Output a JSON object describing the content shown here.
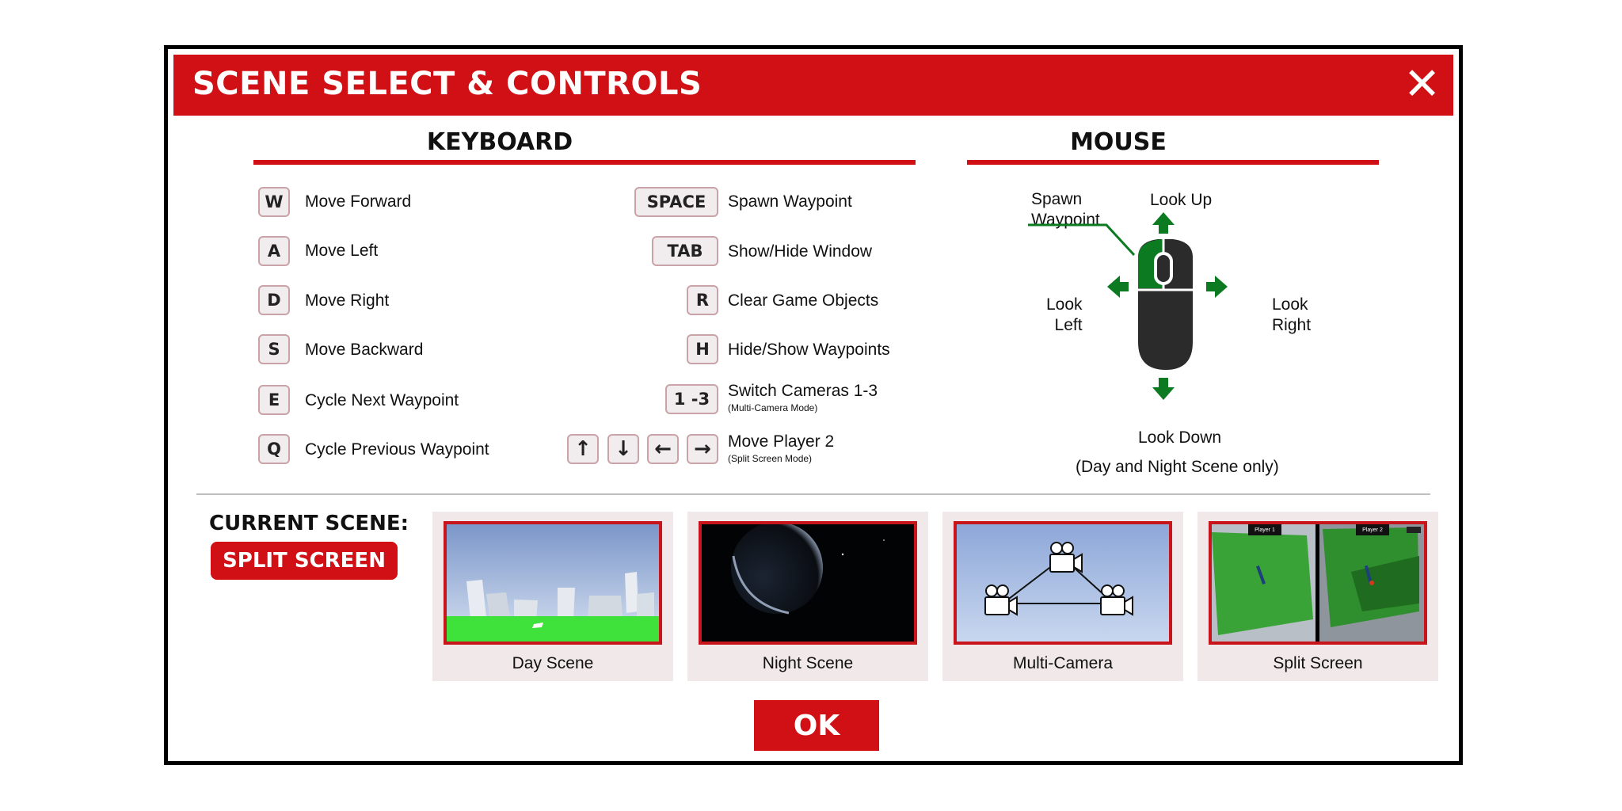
{
  "dialog": {
    "title": "SCENE SELECT & CONTROLS",
    "close_symbol": "✕"
  },
  "keyboard": {
    "heading": "KEYBOARD",
    "left": [
      {
        "key": "W",
        "action": "Move Forward"
      },
      {
        "key": "A",
        "action": "Move Left"
      },
      {
        "key": "D",
        "action": "Move Right"
      },
      {
        "key": "S",
        "action": "Move Backward"
      },
      {
        "key": "E",
        "action": "Cycle Next Waypoint"
      },
      {
        "key": "Q",
        "action": "Cycle Previous Waypoint"
      }
    ],
    "right": [
      {
        "key": "SPACE",
        "action": "Spawn Waypoint"
      },
      {
        "key": "TAB",
        "action": "Show/Hide Window"
      },
      {
        "key": "R",
        "action": "Clear Game Objects"
      },
      {
        "key": "H",
        "action": "Hide/Show Waypoints"
      },
      {
        "key": "1 -3",
        "action": "Switch Cameras 1-3",
        "note": "(Multi-Camera Mode)"
      },
      {
        "keys": [
          "↑",
          "↓",
          "←",
          "→"
        ],
        "action": "Move Player 2",
        "note": "(Split Screen Mode)"
      }
    ]
  },
  "mouse": {
    "heading": "MOUSE",
    "spawn_line1": "Spawn",
    "spawn_line2": "Waypoint",
    "look_up": "Look Up",
    "look_left_1": "Look",
    "look_left_2": "Left",
    "look_right_1": "Look",
    "look_right_2": "Right",
    "look_down": "Look Down",
    "note": "(Day and Night Scene only)",
    "colors": {
      "button_active": "#0c7a20",
      "body": "#2b2b2b",
      "arrow": "#0c7a20"
    }
  },
  "current_scene": {
    "label": "CURRENT SCENE:",
    "value": "SPLIT SCREEN"
  },
  "scenes": [
    {
      "label": "Day Scene"
    },
    {
      "label": "Night Scene"
    },
    {
      "label": "Multi-Camera"
    },
    {
      "label": "Split Screen",
      "p1": "Player 1",
      "p2": "Player 2"
    }
  ],
  "ok_label": "OK",
  "colors": {
    "accent": "#d01015",
    "key_border": "#c9a3a7",
    "card_bg": "#f0e8e9"
  }
}
